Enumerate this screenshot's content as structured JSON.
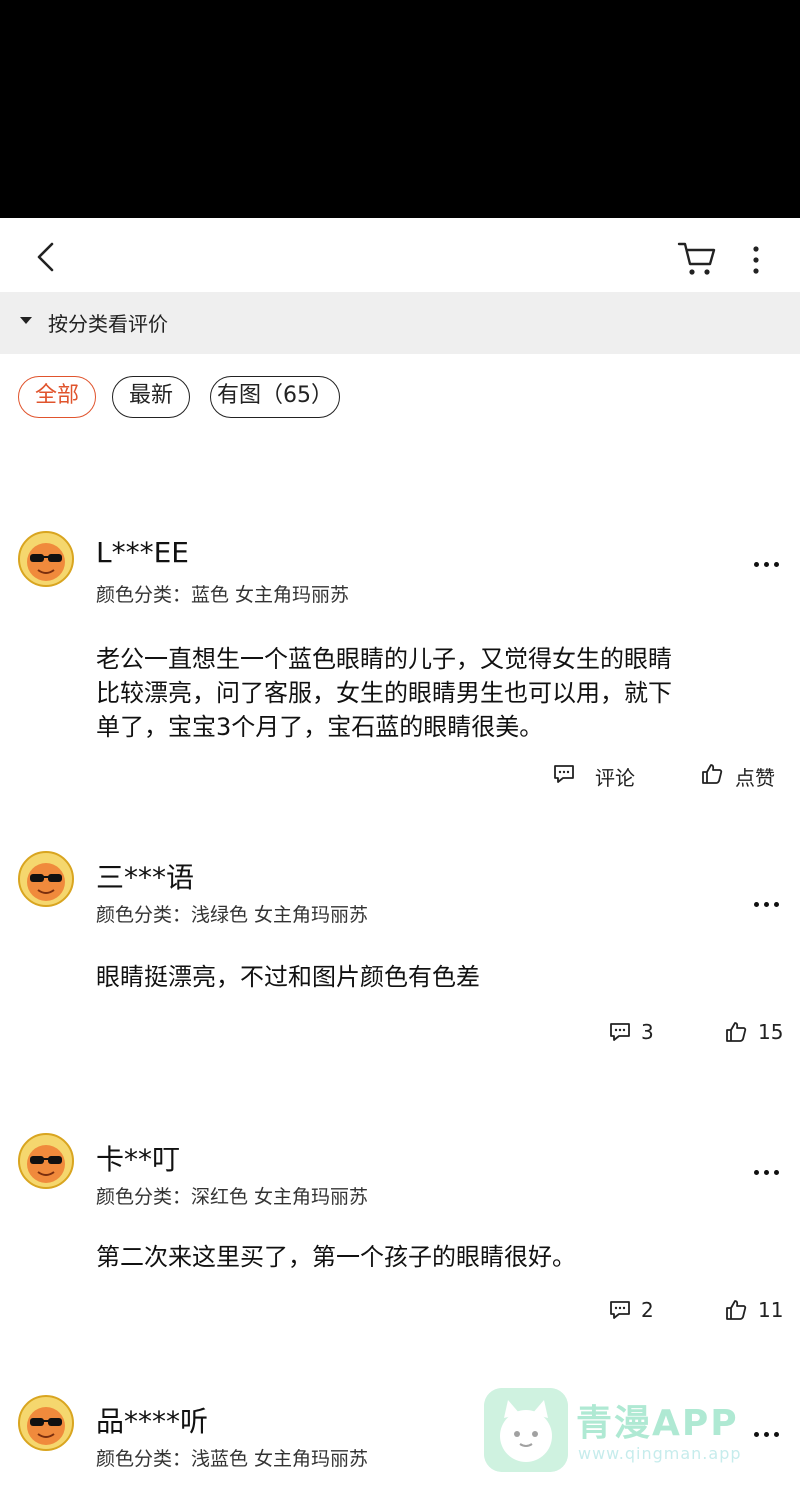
{
  "nav": {
    "back_icon": "back-chevron-icon",
    "cart_icon": "cart-icon",
    "more_icon": "more-vertical-icon"
  },
  "category_bar": {
    "label": "按分类看评价",
    "icon": "caret-down-icon"
  },
  "filters": [
    {
      "label": "全部",
      "active": true
    },
    {
      "label": "最新",
      "active": false
    },
    {
      "label": "有图（65）",
      "active": false
    }
  ],
  "colors": {
    "accent": "#e0542d",
    "divider_bg": "#efefef",
    "text": "#111111"
  },
  "reviews": [
    {
      "user": "L***EE",
      "spec": "颜色分类：蓝色 女主角玛丽苏",
      "lines": [
        "老公一直想生一个蓝色眼睛的儿子，又觉得女生的眼睛",
        "比较漂亮，问了客服，女生的眼睛男生也可以用，就下",
        "单了，宝宝3个月了，宝石蓝的眼睛很美。"
      ],
      "comment_label": "评论",
      "like_label": "点赞"
    },
    {
      "user": "三***语",
      "spec": "颜色分类：浅绿色 女主角玛丽苏",
      "lines": [
        "眼睛挺漂亮，不过和图片颜色有色差"
      ],
      "comment_label": "3",
      "like_label": "15"
    },
    {
      "user": "卡**叮",
      "spec": "颜色分类：深红色 女主角玛丽苏",
      "lines": [
        "第二次来这里买了，第一个孩子的眼睛很好。"
      ],
      "comment_label": "2",
      "like_label": "11"
    },
    {
      "user": "品****听",
      "spec": "颜色分类：浅蓝色 女主角玛丽苏",
      "lines": [],
      "comment_label": "",
      "like_label": ""
    }
  ],
  "watermark": {
    "title": "青漫APP",
    "url": "www.qingman.app"
  }
}
